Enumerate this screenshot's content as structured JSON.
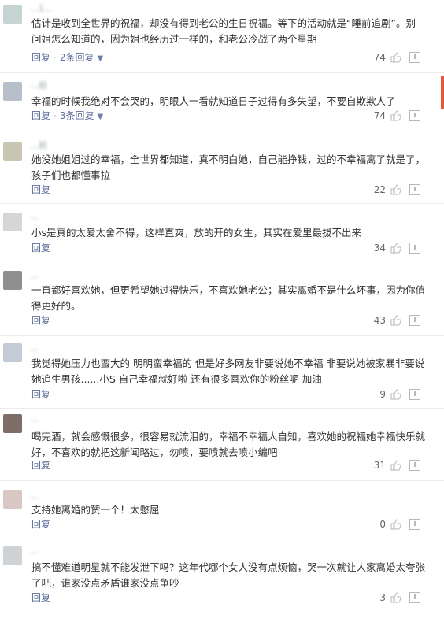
{
  "comments": [
    {
      "username": "…1…",
      "text": "估计是收到全世界的祝福，却没有得到老公的生日祝福。等下的活动就是“睡前追剧”。别问姐怎么知道的，因为姐也经历过一样的，和老公冷战了两个星期",
      "reply": "回复",
      "sub_replies": "2条回复",
      "likes": "74"
    },
    {
      "username": "…前",
      "text": "幸福的时候我绝对不会哭的，明眼人一看就知道日子过得有多失望，不要自欺欺人了",
      "reply": "回复",
      "sub_replies": "3条回复",
      "likes": "74"
    },
    {
      "username": "…前",
      "text": "她没她姐姐过的幸福，全世界都知道，真不明白她，自己能挣钱，过的不幸福离了就是了，孩子们也都懂事拉",
      "reply": "回复",
      "likes": "22"
    },
    {
      "username": "…",
      "text": "小s是真的太爱太舍不得，这样直爽，放的开的女生，其实在爱里最拔不出来",
      "reply": "回复",
      "likes": "34"
    },
    {
      "username": "…",
      "text": "一直都好喜欢她，但更希望她过得快乐，不喜欢她老公；其实离婚不是什么坏事，因为你值得更好的。",
      "reply": "回复",
      "likes": "43"
    },
    {
      "username": "…",
      "text": "我觉得她压力也蛮大的 明明蛮幸福的 但是好多网友非要说她不幸福 非要说她被家暴非要说她追生男孩......小S 自己幸福就好啦 还有很多喜欢你的粉丝呢 加油",
      "reply": "回复",
      "likes": "9"
    },
    {
      "username": "…",
      "text": "喝完酒，就会感慨很多，很容易就流泪的，幸福不幸福人自知，喜欢她的祝福她幸福快乐就好，不喜欢的就把这新闻略过，勿喷，要喷就去喷小编吧",
      "reply": "回复",
      "likes": "31"
    },
    {
      "username": "…",
      "text": "支持她离婚的赞一个！太憋屈",
      "reply": "回复",
      "likes": "0"
    },
    {
      "username": "…",
      "text": "搞不懂难道明星就不能发泄下吗？这年代哪个女人没有点烦恼，哭一次就让人家离婚太夸张了吧，谁家没点矛盾谁家没点争吵",
      "reply": "回复",
      "likes": "3"
    }
  ],
  "colors": {
    "link": "#5b6e9a",
    "accent": "#e25a3a"
  }
}
